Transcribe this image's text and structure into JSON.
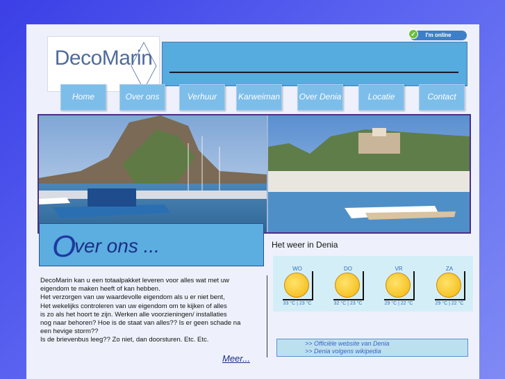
{
  "logo": {
    "text": "DecoMarin"
  },
  "status": {
    "online_label": "I'm online"
  },
  "nav": {
    "items": [
      {
        "label": "Home"
      },
      {
        "label": "Over ons"
      },
      {
        "label": "Verhuur"
      },
      {
        "label": "Karweiman"
      },
      {
        "label": "Over Denia"
      },
      {
        "label": "Locatie"
      },
      {
        "label": "Contact"
      }
    ]
  },
  "over": {
    "first_letter": "O",
    "rest": "ver ons ..."
  },
  "body": {
    "lines": [
      "DecoMarin kan u een totaalpakket leveren voor alles wat met uw",
      "eigendom te maken heeft of kan hebben.",
      "Het verzorgen van uw waardevolle eigendom als u er niet bent,",
      "Het wekelijks controleren van uw eigendom om te kijken of alles",
      "is zo als het hoort te zijn. Werken alle voorzieningen/ installaties",
      "nog naar behoren? Hoe is de staat van alles?? Is er geen schade na",
      "een hevige storm??",
      "Is de brievenbus leeg?? Zo niet, dan doorsturen. Etc. Etc."
    ],
    "more_label": "Meer..."
  },
  "weather": {
    "title": "Het weer in Denia",
    "days": [
      {
        "day": "WO",
        "temp": "33 °C | 23 °C"
      },
      {
        "day": "DO",
        "temp": "32 °C | 23 °C"
      },
      {
        "day": "VR",
        "temp": "29 °C | 22 °C"
      },
      {
        "day": "ZA",
        "temp": "29 °C | 22 °C"
      }
    ]
  },
  "links": {
    "items": [
      ">> Officiële website van Denia",
      ">> Denia volgens wikipedia"
    ]
  },
  "colors": {
    "background": "#3b3fe6",
    "banner": "#56abdf",
    "nav": "#7dbde9",
    "accent": "#1a2f86"
  }
}
